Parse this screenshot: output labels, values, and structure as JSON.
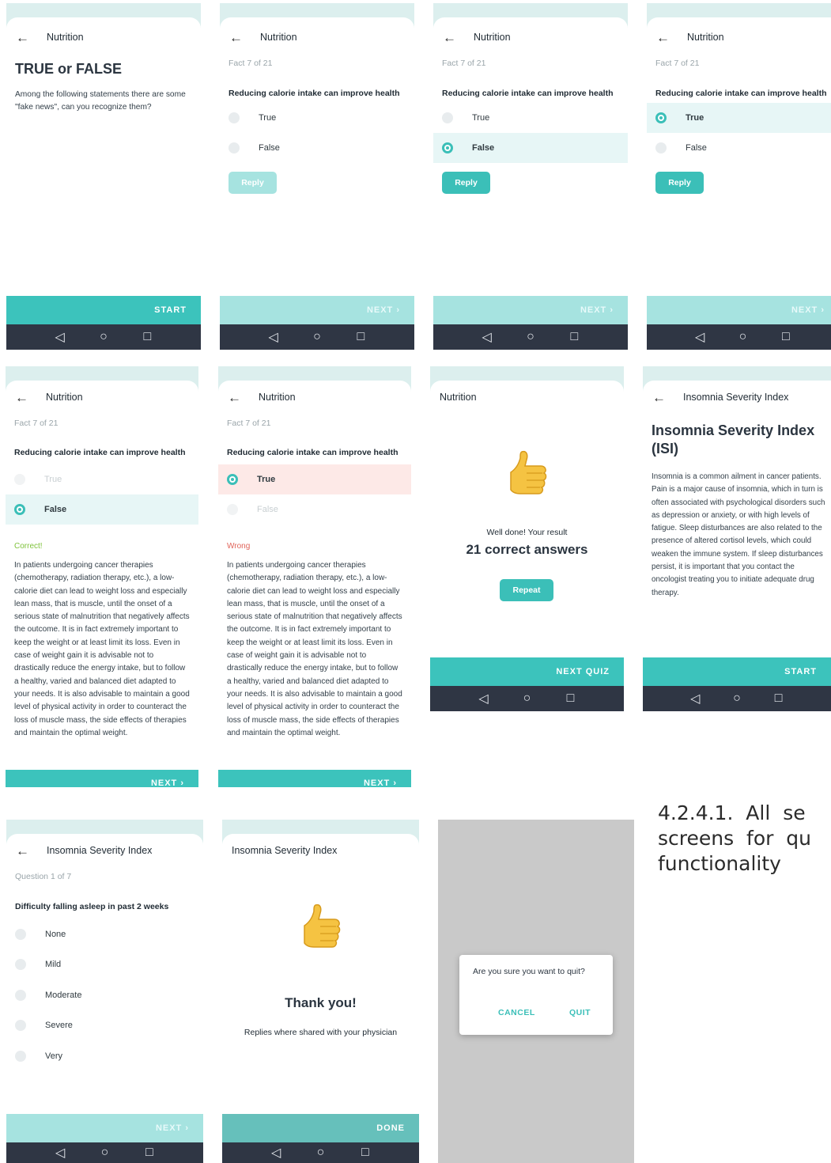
{
  "nav": {
    "back": "◁",
    "home": "○",
    "recent": "□"
  },
  "colors": {
    "accent": "#3bbfb8",
    "accent_light": "#a6e3e0",
    "nav_bg": "#2f3644",
    "wrong_bg": "#fde9e7",
    "selected_bg": "#e7f6f6",
    "correct_text": "#7ec23a",
    "wrong_text": "#e0645a"
  },
  "s1": {
    "title": "Nutrition",
    "heading": "TRUE or FALSE",
    "body": "Among the following statements there are some \"fake news\", can you recognize them?",
    "button": "START"
  },
  "s2": {
    "title": "Nutrition",
    "fact": "Fact 7 of 21",
    "question": "Reducing calorie intake can improve health",
    "opt_true": "True",
    "opt_false": "False",
    "reply": "Reply",
    "next": "NEXT  ›"
  },
  "s3": {
    "title": "Nutrition",
    "fact": "Fact 7 of 21",
    "question": "Reducing calorie intake can improve health",
    "opt_true": "True",
    "opt_false": "False",
    "reply": "Reply",
    "next": "NEXT  ›"
  },
  "s4": {
    "title": "Nutrition",
    "fact": "Fact 7 of 21",
    "question": "Reducing calorie intake can improve health",
    "opt_true": "True",
    "opt_false": "False",
    "reply": "Reply",
    "next": "NEXT  ›"
  },
  "s5": {
    "title": "Nutrition",
    "fact": "Fact 7 of 21",
    "question": "Reducing calorie intake can improve health",
    "opt_true": "True",
    "opt_false": "False",
    "verdict": "Correct!",
    "explanation": "In patients undergoing cancer therapies (chemotherapy, radiation therapy, etc.), a low-calorie diet can lead to weight loss and especially lean mass, that is muscle, until the onset of a serious state of malnutrition that negatively affects the outcome. It is in fact extremely important to keep the weight or at least limit its loss. Even in case of weight gain it is advisable not to drastically reduce the energy intake, but to follow a healthy, varied and balanced diet adapted to your needs. It is also advisable to maintain a good level of physical activity in order to counteract the loss of muscle mass, the side effects of therapies and maintain the optimal weight.",
    "next": "NEXT  ›"
  },
  "s6": {
    "title": "Nutrition",
    "fact": "Fact 7 of 21",
    "question": "Reducing calorie intake can improve health",
    "opt_true": "True",
    "opt_false": "False",
    "verdict": "Wrong",
    "explanation": "In patients undergoing cancer therapies (chemotherapy, radiation therapy, etc.), a low-calorie diet can lead to weight loss and especially lean mass, that is muscle, until the onset of a serious state of malnutrition that negatively affects the outcome. It is in fact extremely important to keep the weight or at least limit its loss. Even in case of weight gain it is advisable not to drastically reduce the energy intake, but to follow a healthy, varied and balanced diet adapted to your needs. It is also advisable to maintain a good level of physical activity in order to counteract the loss of muscle mass, the side effects of therapies and maintain the optimal weight.",
    "next": "NEXT  ›"
  },
  "s7": {
    "title": "Nutrition",
    "subtitle": "Well done! Your result",
    "result": "21 correct answers",
    "repeat": "Repeat",
    "next": "NEXT QUIZ"
  },
  "s8": {
    "title": "Insomnia Severity Index",
    "heading": "Insomnia Severity Index (ISI)",
    "body": "Insomnia is a common ailment in cancer patients. Pain is a major cause of insomnia, which in turn is often associated with psychological disorders such as depression or anxiety, or with high levels of fatigue. Sleep disturbances are also related to the presence of altered cortisol levels, which could weaken the immune system. If sleep disturbances persist, it is important that you contact the oncologist treating you to initiate adequate drug therapy.",
    "button": "START"
  },
  "s9": {
    "title": "Insomnia Severity Index",
    "progress": "Question 1 of 7",
    "question": "Difficulty falling asleep in past 2 weeks",
    "options": [
      "None",
      "Mild",
      "Moderate",
      "Severe",
      "Very"
    ],
    "next": "NEXT  ›"
  },
  "s10": {
    "title": "Insomnia Severity Index",
    "heading": "Thank you!",
    "body": "Replies where shared with your physician",
    "button": "DONE"
  },
  "s11": {
    "question": "Are you sure you want to quit?",
    "cancel": "CANCEL",
    "quit": "QUIT"
  },
  "caption": "4.2.4.1.  All  se\nscreens  for  qu\nfunctionality"
}
